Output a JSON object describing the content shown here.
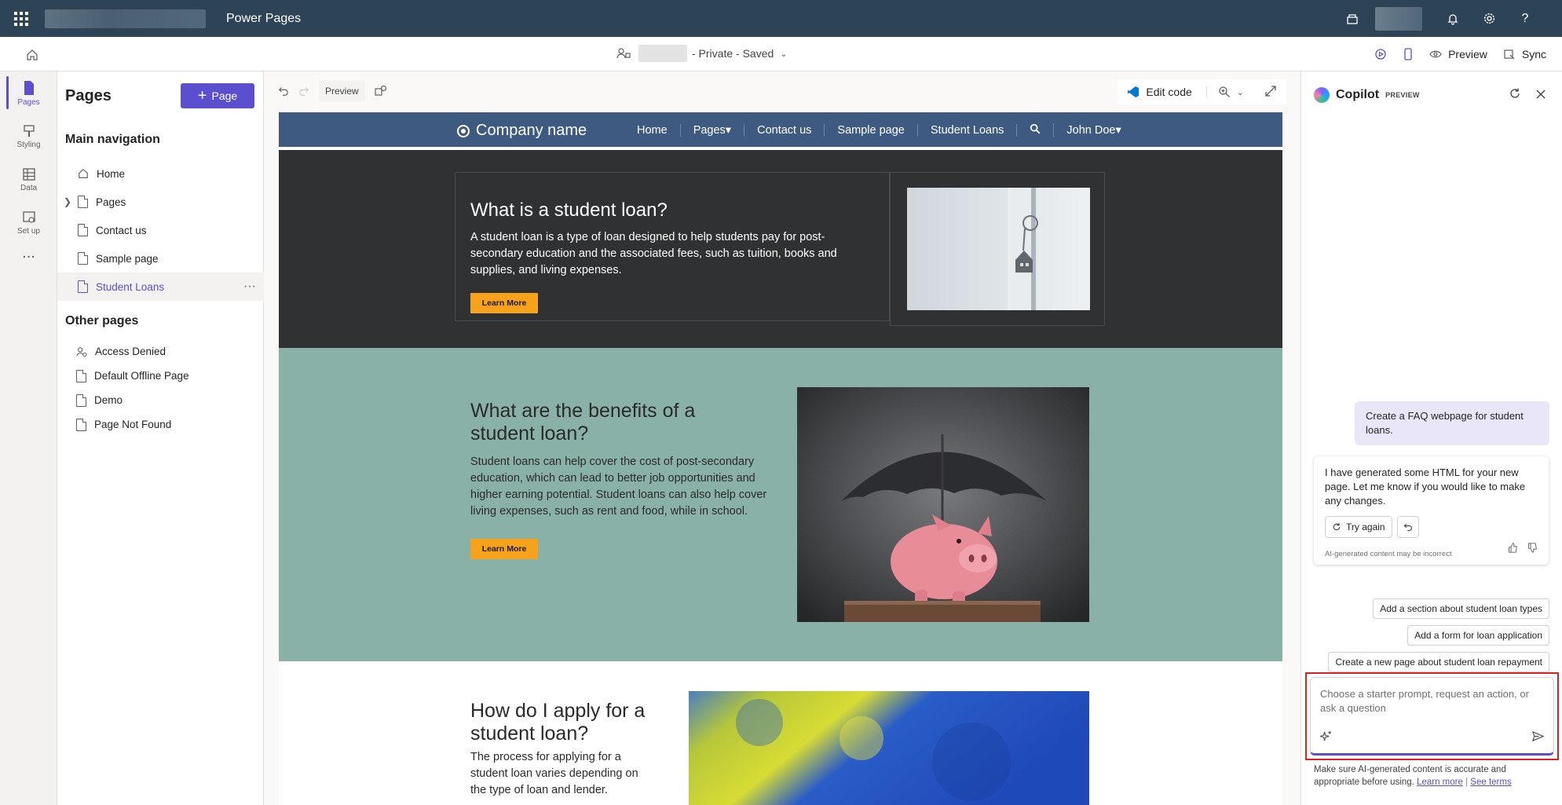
{
  "topbar": {
    "app_title": "Power Pages",
    "icons": [
      "waffle-icon",
      "environment-icon",
      "bell-icon",
      "gear-icon",
      "help-icon"
    ]
  },
  "cmdbar": {
    "site_status": "- Private - Saved",
    "preview_label": "Preview",
    "sync_label": "Sync"
  },
  "rail": {
    "items": [
      {
        "label": "Pages",
        "icon": "pages-icon"
      },
      {
        "label": "Styling",
        "icon": "styling-icon"
      },
      {
        "label": "Data",
        "icon": "data-icon"
      },
      {
        "label": "Set up",
        "icon": "setup-icon"
      }
    ],
    "more": "..."
  },
  "pages_panel": {
    "title": "Pages",
    "add_label": "Page",
    "main_nav_heading": "Main navigation",
    "main_nav": [
      {
        "label": "Home"
      },
      {
        "label": "Pages"
      },
      {
        "label": "Contact us"
      },
      {
        "label": "Sample page"
      },
      {
        "label": "Student Loans"
      }
    ],
    "other_heading": "Other pages",
    "other_pages": [
      {
        "label": "Access Denied"
      },
      {
        "label": "Default Offline Page"
      },
      {
        "label": "Demo"
      },
      {
        "label": "Page Not Found"
      }
    ]
  },
  "canvas": {
    "preview_chip": "Preview",
    "edit_code": "Edit code"
  },
  "site": {
    "brand": "Company name",
    "links": [
      "Home",
      "Pages▾",
      "Contact us",
      "Sample page",
      "Student Loans",
      "",
      "John Doe▾"
    ],
    "sec1": {
      "heading": "What is a student loan?",
      "body": "A student loan is a type of loan designed to help students pay for post-secondary education and the associated fees, such as tuition, books and supplies, and living expenses.",
      "button": "Learn More"
    },
    "sec2": {
      "heading": "What are the benefits of a student loan?",
      "body": "Student loans can help cover the cost of post-secondary education, which can lead to better job opportunities and higher earning potential. Student loans can also help cover living expenses, such as rent and food, while in school.",
      "button": "Learn More"
    },
    "sec3": {
      "heading": "How do I apply for a student loan?",
      "body": "The process for applying for a student loan varies depending on the type of loan and lender."
    }
  },
  "copilot": {
    "title": "Copilot",
    "badge": "PREVIEW",
    "user_message": "Create a FAQ webpage for student loans.",
    "bot_message": "I have generated some HTML for your new page. Let me know if you would like to make any changes.",
    "try_again": "Try again",
    "disclaimer": "AI-generated content may be incorrect",
    "suggestions": [
      "Add a section about student loan types",
      "Add a form for loan application",
      "Create a new page about student loan repayment"
    ],
    "input_placeholder": "Choose a starter prompt, request an action, or ask a question",
    "footer_text": "Make sure AI-generated content is accurate and appropriate before using.",
    "learn_more": "Learn more",
    "see_terms": "See terms"
  }
}
